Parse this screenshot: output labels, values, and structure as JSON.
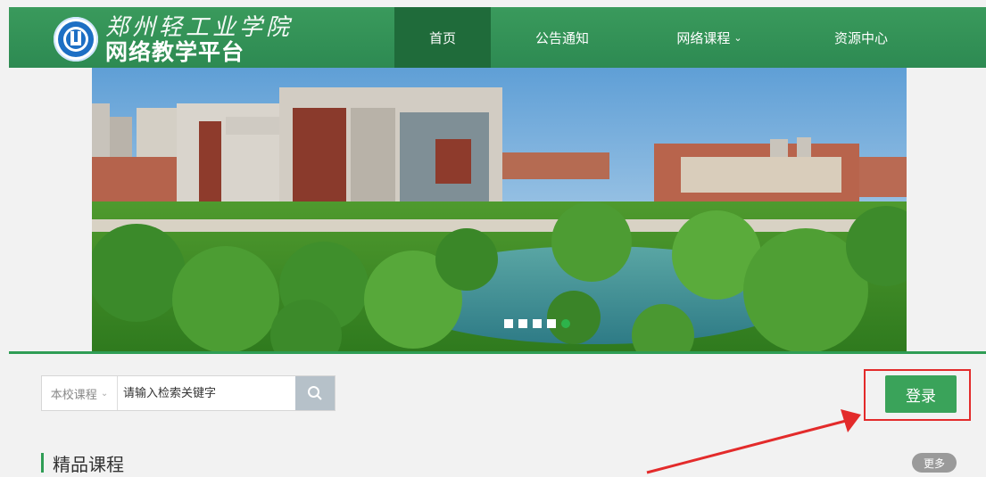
{
  "header": {
    "school_name": "郑州轻工业学院",
    "platform_name": "网络教学平台",
    "emblem": "university-emblem",
    "brand_color": "#2e8b57"
  },
  "nav": {
    "items": [
      {
        "label": "首页",
        "active": true
      },
      {
        "label": "公告通知"
      },
      {
        "label": "网络课程",
        "icon": "chevron-down-icon"
      },
      {
        "label": "资源中心"
      }
    ]
  },
  "banner": {
    "slide_count": 5,
    "active_index": 4
  },
  "search": {
    "scope_label": "本校课程",
    "placeholder": "请输入检索关键字",
    "button_icon": "search-icon"
  },
  "login": {
    "label": "登录",
    "highlight_color": "#e32b2b"
  },
  "section": {
    "title": "精品课程",
    "more_label": "更多"
  }
}
